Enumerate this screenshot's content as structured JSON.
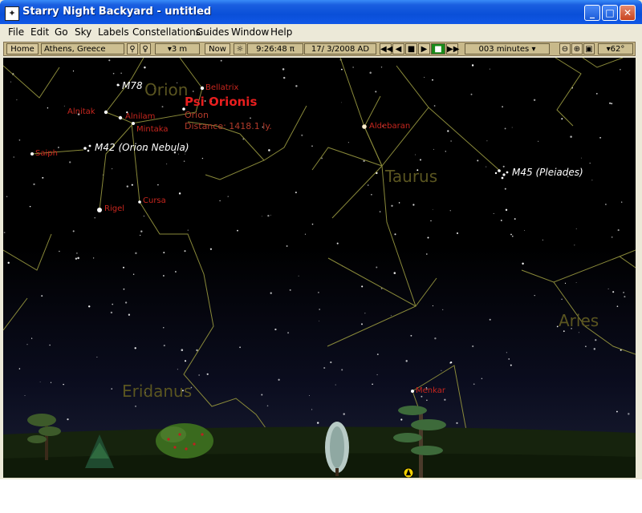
{
  "window": {
    "title": "Starry Night Backyard - untitled"
  },
  "titlebar": {
    "minimize": "_",
    "maximize": "□",
    "close": "✕"
  },
  "menu": [
    "File",
    "Edit",
    "Go",
    "Sky",
    "Labels",
    "Constellations",
    "Guides",
    "Window",
    "Help"
  ],
  "toolbar": {
    "home": "Home",
    "location": "Athens, Greece",
    "elevation": "▾3 m",
    "now": "Now",
    "time": "9:26:48 π",
    "date": "17/ 3/2008 AD",
    "step": "003 minutes ▾",
    "fov": "▾62°"
  },
  "info": {
    "name": "Psi Orionis",
    "constellation": "Orion",
    "distance": "Distance: 1418.1 ly."
  },
  "constellation_labels": [
    "Orion",
    "Taurus",
    "Eridanus",
    "Aries"
  ],
  "star_labels": [
    "Bellatrix",
    "Alnitak",
    "Alnilam",
    "Mintaka",
    "Saiph",
    "Rigel",
    "Cursa",
    "Aldebaran",
    "Menkar"
  ],
  "deep_sky_labels": [
    "M78",
    "M42 (Orion Nebula)",
    "M45 (Pleiades)"
  ]
}
